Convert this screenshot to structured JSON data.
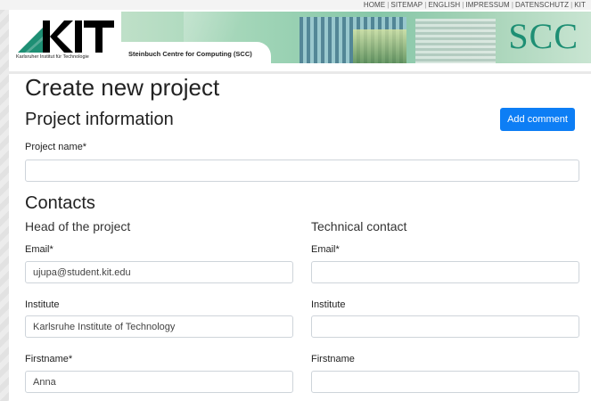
{
  "topnav": {
    "items": [
      "HOME",
      "SITEMAP",
      "ENGLISH",
      "IMPRESSUM",
      "DATENSCHUTZ",
      "KIT"
    ]
  },
  "header": {
    "kit_logo_text": "KIT",
    "kit_subtitle": "Karlsruher Institut für Technologie",
    "banner_label": "Steinbuch Centre for Computing (SCC)",
    "scc_logo_text": "SCC"
  },
  "page": {
    "title": "Create new project",
    "project_info_heading": "Project information",
    "add_comment_label": "Add comment",
    "project_name_label": "Project name*",
    "project_name_value": "",
    "contacts_heading": "Contacts"
  },
  "head_of_project": {
    "heading": "Head of the project",
    "email_label": "Email*",
    "email_value": "ujupa@student.kit.edu",
    "institute_label": "Institute",
    "institute_value": "Karlsruhe Institute of Technology",
    "firstname_label": "Firstname*",
    "firstname_value": "Anna"
  },
  "technical_contact": {
    "heading": "Technical contact",
    "email_label": "Email*",
    "email_value": "",
    "institute_label": "Institute",
    "institute_value": "",
    "firstname_label": "Firstname",
    "firstname_value": ""
  },
  "colors": {
    "primary_button": "#0d7ef5",
    "scc_green": "#1e8f74"
  }
}
